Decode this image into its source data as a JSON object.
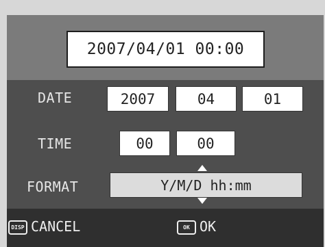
{
  "preview": {
    "value": "2007/04/01 00:00"
  },
  "date": {
    "label": "DATE",
    "year": "2007",
    "month": "04",
    "day": "01"
  },
  "time": {
    "label": "TIME",
    "hour": "00",
    "minute": "00"
  },
  "format": {
    "label": "FORMAT",
    "value": "Y/M/D hh:mm"
  },
  "footer": {
    "cancel_key": "DISP",
    "cancel_label": "CANCEL",
    "ok_key": "OK",
    "ok_label": "OK"
  },
  "icons": {
    "up": "arrow-up-icon",
    "down": "arrow-down-icon"
  }
}
